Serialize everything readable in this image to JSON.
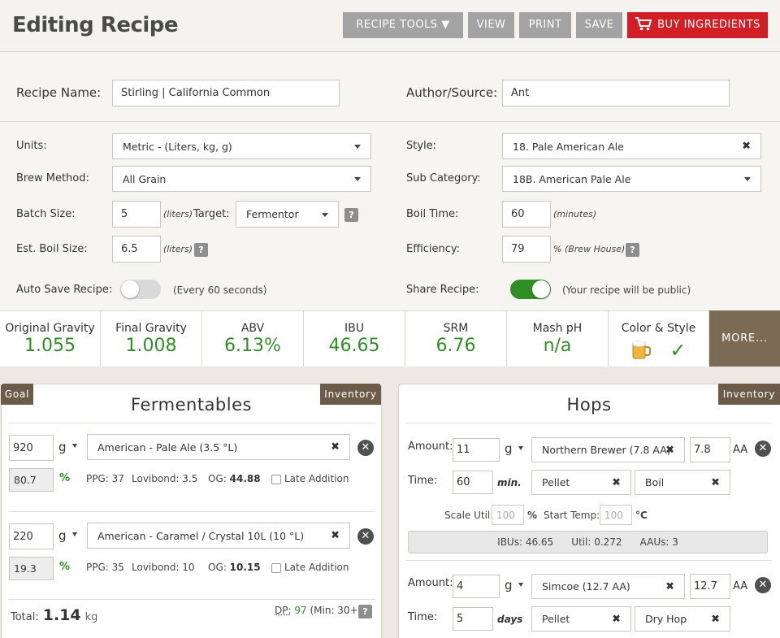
{
  "header": {
    "title": "Editing Recipe",
    "buttons": {
      "recipe_tools": "RECIPE TOOLS ▼",
      "view": "VIEW",
      "print": "PRINT",
      "save": "SAVE",
      "buy": "BUY INGREDIENTS"
    }
  },
  "form": {
    "recipe_name": {
      "label": "Recipe Name:",
      "value": "Stirling | California Common"
    },
    "author": {
      "label": "Author/Source:",
      "value": "Ant"
    },
    "units": {
      "label": "Units:",
      "value": "Metric - (Liters, kg, g)"
    },
    "brew_method": {
      "label": "Brew Method:",
      "value": "All Grain"
    },
    "batch_size": {
      "label": "Batch Size:",
      "value": "5",
      "unit": "(liters)",
      "target_label": "Target:",
      "target_value": "Fermentor"
    },
    "boil_size": {
      "label": "Est. Boil Size:",
      "value": "6.5",
      "unit": "(liters)"
    },
    "auto_save": {
      "label": "Auto Save Recipe:",
      "note": "(Every 60 seconds)",
      "on": false
    },
    "style": {
      "label": "Style:",
      "value": "18. Pale American Ale"
    },
    "sub_category": {
      "label": "Sub Category:",
      "value": "18B. American Pale Ale"
    },
    "boil_time": {
      "label": "Boil Time:",
      "value": "60",
      "unit": "(minutes)"
    },
    "efficiency": {
      "label": "Efficiency:",
      "value": "79",
      "unit": "% (Brew House)"
    },
    "share": {
      "label": "Share Recipe:",
      "note": "(Your recipe will be public)",
      "on": true
    },
    "help": "?"
  },
  "stats": [
    {
      "label": "Original Gravity",
      "value": "1.055"
    },
    {
      "label": "Final Gravity",
      "value": "1.008"
    },
    {
      "label": "ABV",
      "value": "6.13%"
    },
    {
      "label": "IBU",
      "value": "46.65"
    },
    {
      "label": "SRM",
      "value": "6.76"
    },
    {
      "label": "Mash pH",
      "value": "n/a"
    },
    {
      "label": "Color & Style",
      "check": "✓"
    }
  ],
  "more_label": "MORE...",
  "fermentables": {
    "title": "Fermentables",
    "goal_tag": "Goal",
    "inventory_tag": "Inventory",
    "items": [
      {
        "amount": "920",
        "unit": "g",
        "name": "American - Pale Ale (3.5 °L)",
        "percent": "80.7",
        "pct_sign": "%",
        "ppg": "PPG: 37",
        "lovibond": "Lovibond: 3.5",
        "og_label": "OG:",
        "og": "44.88",
        "late": "Late Addition"
      },
      {
        "amount": "220",
        "unit": "g",
        "name": "American - Caramel / Crystal 10L (10 °L)",
        "percent": "19.3",
        "pct_sign": "%",
        "ppg": "PPG: 35",
        "lovibond": "Lovibond: 10",
        "og_label": "OG:",
        "og": "10.15",
        "late": "Late Addition"
      }
    ],
    "total_label": "Total:",
    "total_value": "1.14",
    "total_unit": "kg",
    "dp_label": "DP:",
    "dp_value": "97",
    "dp_min": "(Min: 30+)"
  },
  "hops": {
    "title": "Hops",
    "inventory_tag": "Inventory",
    "items": [
      {
        "amount_label": "Amount:",
        "amount": "11",
        "unit": "g",
        "name": "Northern Brewer (7.8 AA)",
        "aa": "7.8",
        "aa_label": "AA",
        "time_label": "Time:",
        "time": "60",
        "time_unit": "min.",
        "form": "Pellet",
        "use": "Boil",
        "scale_label": "Scale Util:",
        "scale_ph": "100",
        "scale_unit": "%",
        "start_label": "Start Temp:",
        "start_ph": "100",
        "start_unit": "°C",
        "ibus": "IBUs:  46.65",
        "util": "Util:  0.272",
        "aaus": "AAUs:  3"
      },
      {
        "amount_label": "Amount:",
        "amount": "4",
        "unit": "g",
        "name": "Simcoe (12.7 AA)",
        "aa": "12.7",
        "aa_label": "AA",
        "time_label": "Time:",
        "time": "5",
        "time_unit": "days",
        "form": "Pellet",
        "use": "Dry Hop"
      }
    ]
  },
  "colors": {
    "accent_green": "#2f8f25",
    "brand_brown": "#7b6a54",
    "buy_red": "#d21f26"
  }
}
